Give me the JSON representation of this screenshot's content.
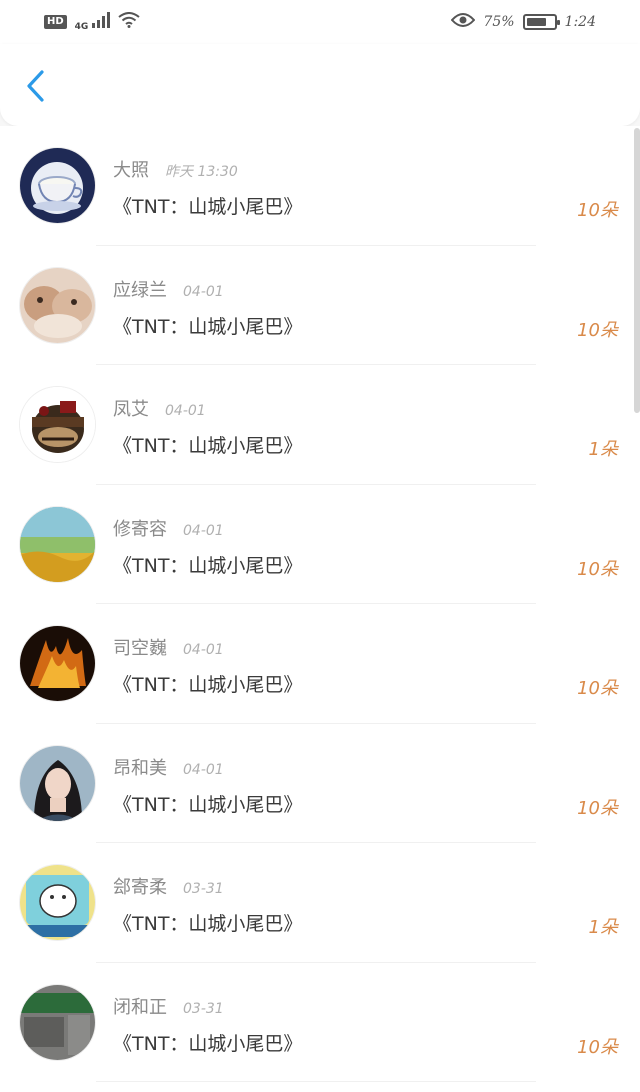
{
  "status_bar": {
    "hd": "HD",
    "network": "4G",
    "battery_percent": "75%",
    "battery_level": 0.75,
    "time": "1:24",
    "icons": [
      "signal-icon",
      "wifi-icon",
      "eye-icon",
      "battery-icon"
    ]
  },
  "header": {
    "back_icon": "chevron-left-icon",
    "accent": "#2b9ae8"
  },
  "colors": {
    "amount": "#d98a4a",
    "name": "#8a8a8a",
    "title": "#3a3a3a"
  },
  "records": [
    {
      "name": "大照",
      "time": "昨天 13:30",
      "title": "《TNT：山城小尾巴》",
      "amount": "10朵"
    },
    {
      "name": "应绿兰",
      "time": "04-01",
      "title": "《TNT：山城小尾巴》",
      "amount": "10朵"
    },
    {
      "name": "凤艾",
      "time": "04-01",
      "title": "《TNT：山城小尾巴》",
      "amount": "1朵"
    },
    {
      "name": "修寄容",
      "time": "04-01",
      "title": "《TNT：山城小尾巴》",
      "amount": "10朵"
    },
    {
      "name": "司空巍",
      "time": "04-01",
      "title": "《TNT：山城小尾巴》",
      "amount": "10朵"
    },
    {
      "name": "昂和美",
      "time": "04-01",
      "title": "《TNT：山城小尾巴》",
      "amount": "10朵"
    },
    {
      "name": "郐寄柔",
      "time": "03-31",
      "title": "《TNT：山城小尾巴》",
      "amount": "1朵"
    },
    {
      "name": "闭和正",
      "time": "03-31",
      "title": "《TNT：山城小尾巴》",
      "amount": "10朵"
    }
  ]
}
